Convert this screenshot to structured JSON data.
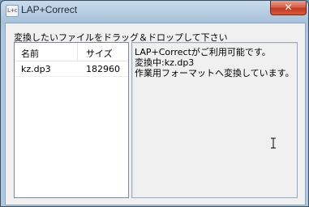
{
  "window": {
    "title": "LAP+Correct",
    "app_icon_text": "L+c",
    "close_symbol": "✕"
  },
  "instruction": "変換したいファイルをドラッグ＆ドロップして下さい",
  "file_list": {
    "columns": [
      "名前",
      "サイズ"
    ],
    "rows": [
      {
        "name": "kz.dp3",
        "size": "182960"
      }
    ]
  },
  "log": {
    "lines": [
      "LAP+Correctがご利用可能です。",
      "変換中:kz.dp3",
      "作業用フォーマットへ変換しています。"
    ]
  }
}
